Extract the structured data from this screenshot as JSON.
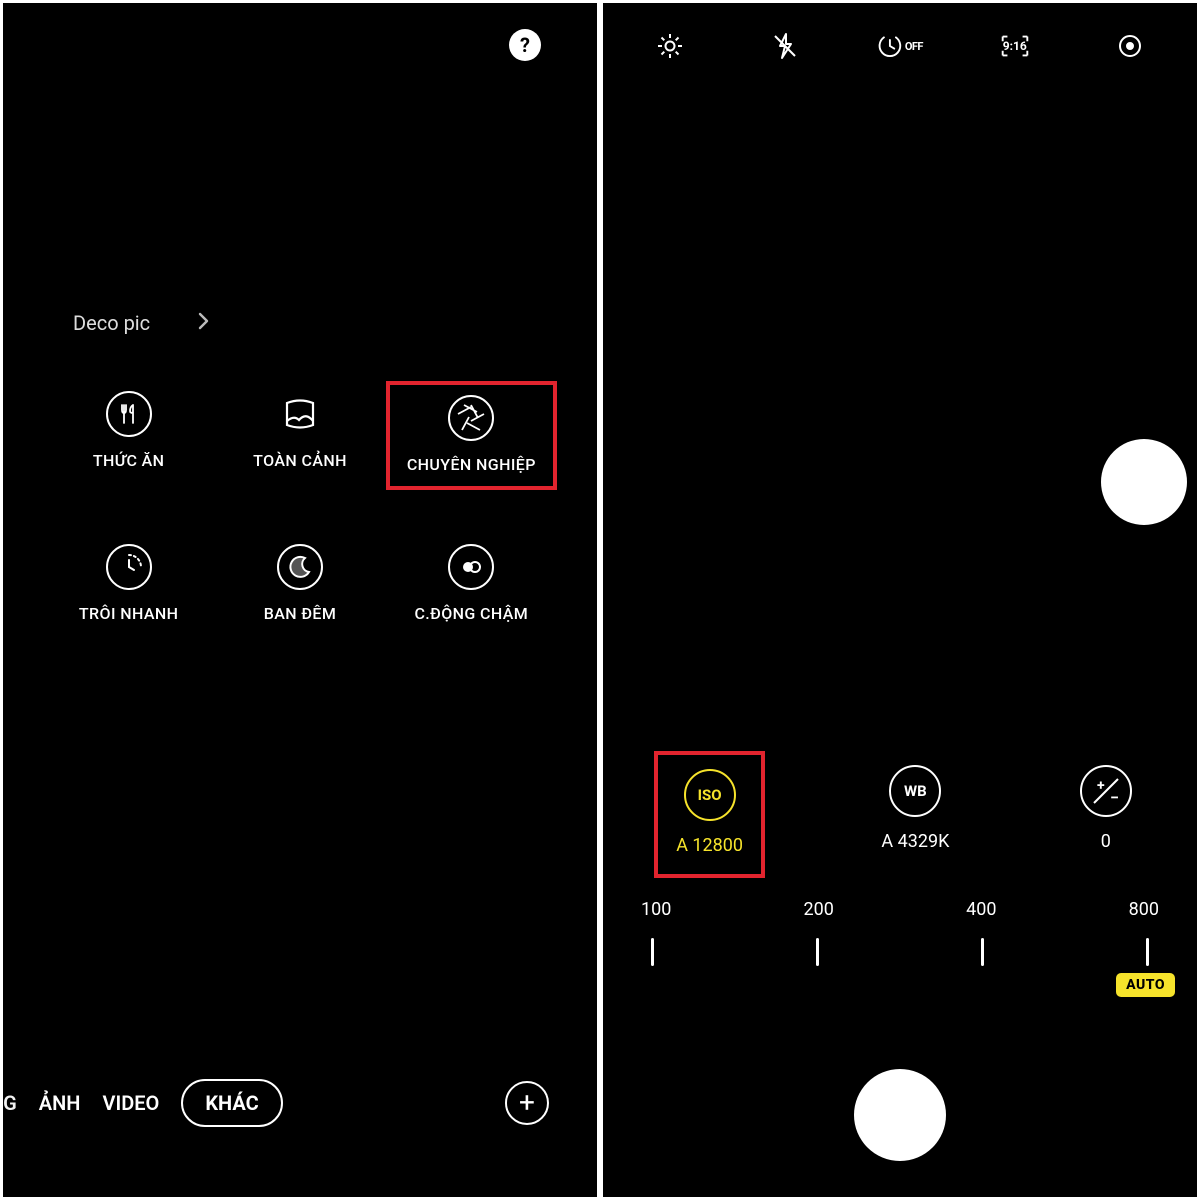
{
  "left": {
    "help": "?",
    "deco_label": "Deco pic",
    "modes": [
      {
        "id": "food",
        "label": "THỨC ĂN"
      },
      {
        "id": "panorama",
        "label": "TOÀN CẢNH"
      },
      {
        "id": "pro",
        "label": "CHUYÊN NGHIỆP"
      },
      {
        "id": "hyperlapse",
        "label": "TRÔI NHANH"
      },
      {
        "id": "night",
        "label": "BAN ĐÊM"
      },
      {
        "id": "slowmo",
        "label": "C.ĐỘNG CHẬM"
      }
    ],
    "tabs": {
      "truncated": "NG",
      "photo": "ẢNH",
      "video": "VIDEO",
      "more": "KHÁC"
    }
  },
  "right": {
    "timer_off": "OFF",
    "aspect": "9:16",
    "params": {
      "iso": {
        "ring": "ISO",
        "value": "A 12800"
      },
      "wb": {
        "ring": "WB",
        "value": "A 4329K"
      },
      "exp": {
        "value": "0"
      }
    },
    "scale": [
      "100",
      "200",
      "400",
      "800"
    ],
    "auto": "AUTO"
  }
}
